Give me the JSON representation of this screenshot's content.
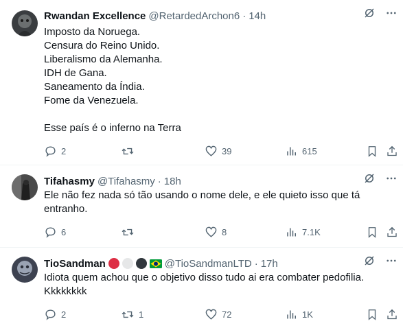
{
  "colors": {
    "secondary": "#536471",
    "text": "#0f1419",
    "divider": "#eff3f4"
  },
  "tweets": [
    {
      "name": "Rwandan Excellence",
      "handle": "@RetardedArchon6",
      "sep": "·",
      "time": "14h",
      "lines": [
        "Imposto da Noruega.",
        "Censura do Reino Unido.",
        "Liberalismo da Alemanha.",
        "IDH de Gana.",
        "Saneamento da Índia.",
        "Fome da Venezuela.",
        "",
        "Esse país é o inferno na Terra"
      ],
      "replies": "2",
      "retweets": "",
      "likes": "39",
      "views": "615"
    },
    {
      "name": "Tifahasmy",
      "handle": "@Tifahasmy",
      "sep": "·",
      "time": "18h",
      "lines": [
        "Ele não fez nada só tão usando o nome dele, e ele quieto isso que tá",
        "entranho."
      ],
      "replies": "6",
      "retweets": "",
      "likes": "8",
      "views": "7.1K"
    },
    {
      "name": "TioSandman",
      "handle": "@TioSandmanLTD",
      "sep": "·",
      "time": "17h",
      "badges": [
        "red-circle",
        "white-circle",
        "black-circle",
        "brazil-flag"
      ],
      "lines": [
        "Idiota quem achou que o objetivo disso tudo ai era combater pedofilia.",
        "Kkkkkkkk"
      ],
      "replies": "2",
      "retweets": "1",
      "likes": "72",
      "views": "1K"
    }
  ]
}
